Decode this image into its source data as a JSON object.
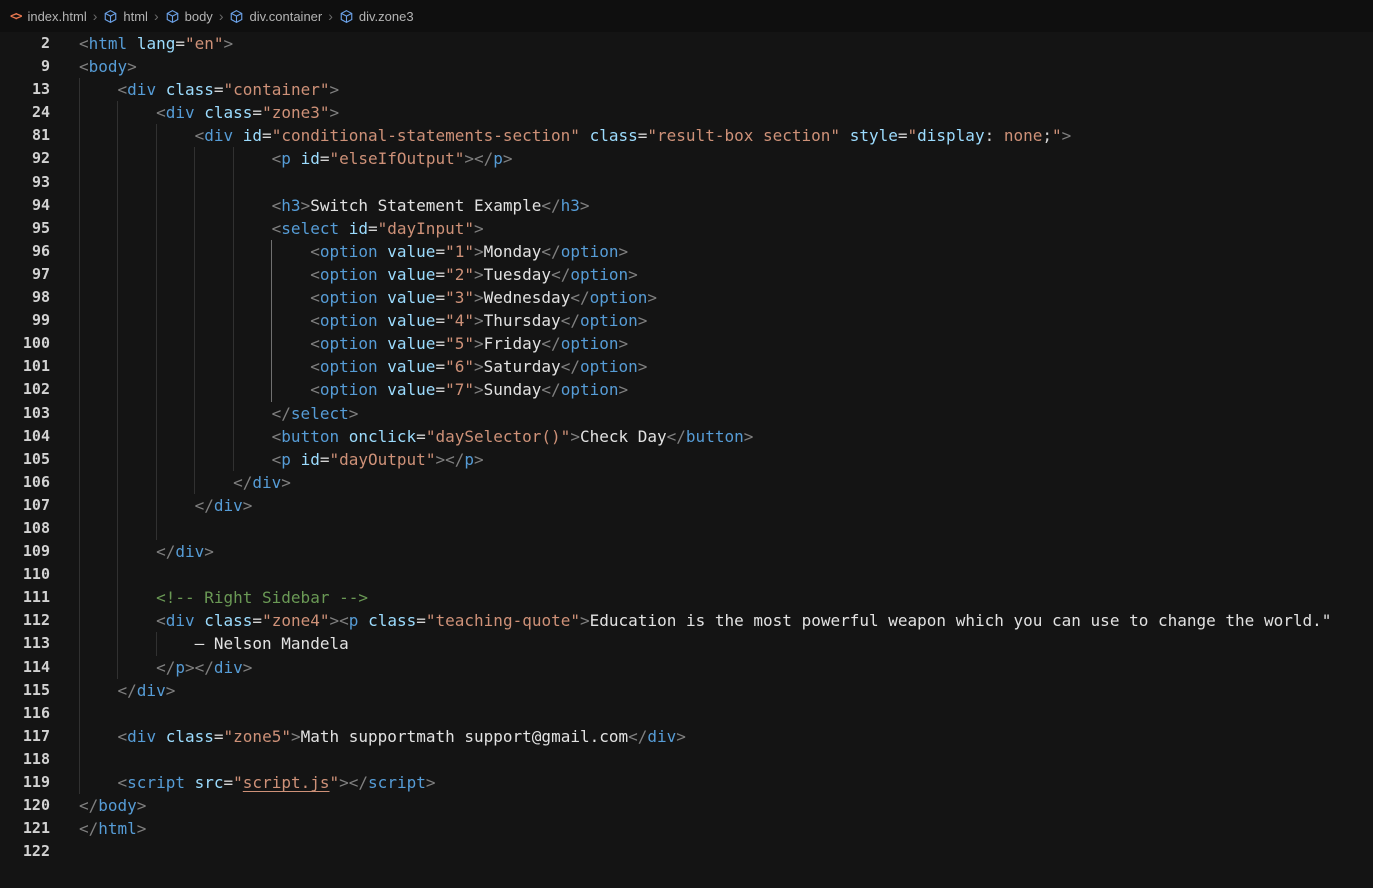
{
  "breadcrumb": {
    "separator": "›",
    "items": [
      {
        "label": "index.html",
        "icon": "html-file-icon"
      },
      {
        "label": "html",
        "icon": "symbol-tag-icon"
      },
      {
        "label": "body",
        "icon": "symbol-tag-icon"
      },
      {
        "label": "div.container",
        "icon": "symbol-tag-icon"
      },
      {
        "label": "div.zone3",
        "icon": "symbol-tag-icon"
      }
    ]
  },
  "colors": {
    "editor_background": "#141414",
    "breadcrumb_background": "#0f0f0f",
    "tag": "#569cd6",
    "attribute": "#9cdcfe",
    "string": "#ce9178",
    "punctuation": "#808080",
    "text": "#e2e2e2",
    "comment": "#6a9955",
    "line_number": "#d2d2d2",
    "indent_guide": "#313131",
    "active_indent_guide": "#707070",
    "html_file_icon": "#e8774f",
    "symbol_icon": "#6ca2e8",
    "link": "#ce9178"
  },
  "editor": {
    "lines": [
      {
        "n": "2",
        "ind": 0,
        "g": 0,
        "tok": [
          [
            "p",
            "<"
          ],
          [
            "tag",
            "html"
          ],
          [
            "t",
            " "
          ],
          [
            "attr",
            "lang"
          ],
          [
            "eq",
            "="
          ],
          [
            "str",
            "\"en\""
          ],
          [
            "p",
            ">"
          ]
        ]
      },
      {
        "n": "9",
        "ind": 0,
        "g": 0,
        "tok": [
          [
            "p",
            "<"
          ],
          [
            "tag",
            "body"
          ],
          [
            "p",
            ">"
          ]
        ]
      },
      {
        "n": "13",
        "ind": 4,
        "g": 1,
        "tok": [
          [
            "p",
            "<"
          ],
          [
            "tag",
            "div"
          ],
          [
            "t",
            " "
          ],
          [
            "attr",
            "class"
          ],
          [
            "eq",
            "="
          ],
          [
            "str",
            "\"container\""
          ],
          [
            "p",
            ">"
          ]
        ]
      },
      {
        "n": "24",
        "ind": 8,
        "g": 2,
        "tok": [
          [
            "p",
            "<"
          ],
          [
            "tag",
            "div"
          ],
          [
            "t",
            " "
          ],
          [
            "attr",
            "class"
          ],
          [
            "eq",
            "="
          ],
          [
            "str",
            "\"zone3\""
          ],
          [
            "p",
            ">"
          ]
        ]
      },
      {
        "n": "81",
        "ind": 12,
        "g": 3,
        "tok": [
          [
            "p",
            "<"
          ],
          [
            "tag",
            "div"
          ],
          [
            "t",
            " "
          ],
          [
            "attr",
            "id"
          ],
          [
            "eq",
            "="
          ],
          [
            "str",
            "\"conditional-statements-section\""
          ],
          [
            "t",
            " "
          ],
          [
            "attr",
            "class"
          ],
          [
            "eq",
            "="
          ],
          [
            "str",
            "\"result-box section\""
          ],
          [
            "t",
            " "
          ],
          [
            "attr",
            "style"
          ],
          [
            "eq",
            "="
          ],
          [
            "str",
            "\""
          ],
          [
            "cprop",
            "display"
          ],
          [
            "eq",
            ": "
          ],
          [
            "str",
            "none"
          ],
          [
            "eq",
            ";"
          ],
          [
            "str",
            "\""
          ],
          [
            "p",
            ">"
          ]
        ]
      },
      {
        "n": "92",
        "ind": 20,
        "g": 5,
        "tok": [
          [
            "p",
            "<"
          ],
          [
            "tag",
            "p"
          ],
          [
            "t",
            " "
          ],
          [
            "attr",
            "id"
          ],
          [
            "eq",
            "="
          ],
          [
            "str",
            "\"elseIfOutput\""
          ],
          [
            "p",
            ">"
          ],
          [
            "p",
            "</"
          ],
          [
            "tag",
            "p"
          ],
          [
            "p",
            ">"
          ]
        ]
      },
      {
        "n": "93",
        "ind": 0,
        "g": 5,
        "tok": []
      },
      {
        "n": "94",
        "ind": 20,
        "g": 5,
        "tok": [
          [
            "p",
            "<"
          ],
          [
            "tag",
            "h3"
          ],
          [
            "p",
            ">"
          ],
          [
            "t",
            "Switch Statement Example"
          ],
          [
            "p",
            "</"
          ],
          [
            "tag",
            "h3"
          ],
          [
            "p",
            ">"
          ]
        ]
      },
      {
        "n": "95",
        "ind": 20,
        "g": 5,
        "tok": [
          [
            "p",
            "<"
          ],
          [
            "tag",
            "select"
          ],
          [
            "t",
            " "
          ],
          [
            "attr",
            "id"
          ],
          [
            "eq",
            "="
          ],
          [
            "str",
            "\"dayInput\""
          ],
          [
            "p",
            ">"
          ]
        ]
      },
      {
        "n": "96",
        "ind": 24,
        "g": 6,
        "a": 5,
        "tok": [
          [
            "p",
            "<"
          ],
          [
            "tag",
            "option"
          ],
          [
            "t",
            " "
          ],
          [
            "attr",
            "value"
          ],
          [
            "eq",
            "="
          ],
          [
            "str",
            "\"1\""
          ],
          [
            "p",
            ">"
          ],
          [
            "t",
            "Monday"
          ],
          [
            "p",
            "</"
          ],
          [
            "tag",
            "option"
          ],
          [
            "p",
            ">"
          ]
        ]
      },
      {
        "n": "97",
        "ind": 24,
        "g": 6,
        "a": 5,
        "tok": [
          [
            "p",
            "<"
          ],
          [
            "tag",
            "option"
          ],
          [
            "t",
            " "
          ],
          [
            "attr",
            "value"
          ],
          [
            "eq",
            "="
          ],
          [
            "str",
            "\"2\""
          ],
          [
            "p",
            ">"
          ],
          [
            "t",
            "Tuesday"
          ],
          [
            "p",
            "</"
          ],
          [
            "tag",
            "option"
          ],
          [
            "p",
            ">"
          ]
        ]
      },
      {
        "n": "98",
        "ind": 24,
        "g": 6,
        "a": 5,
        "tok": [
          [
            "p",
            "<"
          ],
          [
            "tag",
            "option"
          ],
          [
            "t",
            " "
          ],
          [
            "attr",
            "value"
          ],
          [
            "eq",
            "="
          ],
          [
            "str",
            "\"3\""
          ],
          [
            "p",
            ">"
          ],
          [
            "t",
            "Wednesday"
          ],
          [
            "p",
            "</"
          ],
          [
            "tag",
            "option"
          ],
          [
            "p",
            ">"
          ]
        ]
      },
      {
        "n": "99",
        "ind": 24,
        "g": 6,
        "a": 5,
        "tok": [
          [
            "p",
            "<"
          ],
          [
            "tag",
            "option"
          ],
          [
            "t",
            " "
          ],
          [
            "attr",
            "value"
          ],
          [
            "eq",
            "="
          ],
          [
            "str",
            "\"4\""
          ],
          [
            "p",
            ">"
          ],
          [
            "t",
            "Thursday"
          ],
          [
            "p",
            "</"
          ],
          [
            "tag",
            "option"
          ],
          [
            "p",
            ">"
          ]
        ]
      },
      {
        "n": "100",
        "ind": 24,
        "g": 6,
        "a": 5,
        "tok": [
          [
            "p",
            "<"
          ],
          [
            "tag",
            "option"
          ],
          [
            "t",
            " "
          ],
          [
            "attr",
            "value"
          ],
          [
            "eq",
            "="
          ],
          [
            "str",
            "\"5\""
          ],
          [
            "p",
            ">"
          ],
          [
            "t",
            "Friday"
          ],
          [
            "p",
            "</"
          ],
          [
            "tag",
            "option"
          ],
          [
            "p",
            ">"
          ]
        ]
      },
      {
        "n": "101",
        "ind": 24,
        "g": 6,
        "a": 5,
        "tok": [
          [
            "p",
            "<"
          ],
          [
            "tag",
            "option"
          ],
          [
            "t",
            " "
          ],
          [
            "attr",
            "value"
          ],
          [
            "eq",
            "="
          ],
          [
            "str",
            "\"6\""
          ],
          [
            "p",
            ">"
          ],
          [
            "t",
            "Saturday"
          ],
          [
            "p",
            "</"
          ],
          [
            "tag",
            "option"
          ],
          [
            "p",
            ">"
          ]
        ]
      },
      {
        "n": "102",
        "ind": 24,
        "g": 6,
        "a": 5,
        "tok": [
          [
            "p",
            "<"
          ],
          [
            "tag",
            "option"
          ],
          [
            "t",
            " "
          ],
          [
            "attr",
            "value"
          ],
          [
            "eq",
            "="
          ],
          [
            "str",
            "\"7\""
          ],
          [
            "p",
            ">"
          ],
          [
            "t",
            "Sunday"
          ],
          [
            "p",
            "</"
          ],
          [
            "tag",
            "option"
          ],
          [
            "p",
            ">"
          ]
        ]
      },
      {
        "n": "103",
        "ind": 20,
        "g": 5,
        "tok": [
          [
            "p",
            "</"
          ],
          [
            "tag",
            "select"
          ],
          [
            "p",
            ">"
          ]
        ]
      },
      {
        "n": "104",
        "ind": 20,
        "g": 5,
        "tok": [
          [
            "p",
            "<"
          ],
          [
            "tag",
            "button"
          ],
          [
            "t",
            " "
          ],
          [
            "attr",
            "onclick"
          ],
          [
            "eq",
            "="
          ],
          [
            "str",
            "\"daySelector()\""
          ],
          [
            "p",
            ">"
          ],
          [
            "t",
            "Check Day"
          ],
          [
            "p",
            "</"
          ],
          [
            "tag",
            "button"
          ],
          [
            "p",
            ">"
          ]
        ]
      },
      {
        "n": "105",
        "ind": 20,
        "g": 5,
        "tok": [
          [
            "p",
            "<"
          ],
          [
            "tag",
            "p"
          ],
          [
            "t",
            " "
          ],
          [
            "attr",
            "id"
          ],
          [
            "eq",
            "="
          ],
          [
            "str",
            "\"dayOutput\""
          ],
          [
            "p",
            ">"
          ],
          [
            "p",
            "</"
          ],
          [
            "tag",
            "p"
          ],
          [
            "p",
            ">"
          ]
        ]
      },
      {
        "n": "106",
        "ind": 16,
        "g": 4,
        "tok": [
          [
            "p",
            "</"
          ],
          [
            "tag",
            "div"
          ],
          [
            "p",
            ">"
          ]
        ]
      },
      {
        "n": "107",
        "ind": 12,
        "g": 3,
        "tok": [
          [
            "p",
            "</"
          ],
          [
            "tag",
            "div"
          ],
          [
            "p",
            ">"
          ]
        ]
      },
      {
        "n": "108",
        "ind": 0,
        "g": 3,
        "tok": []
      },
      {
        "n": "109",
        "ind": 8,
        "g": 2,
        "tok": [
          [
            "p",
            "</"
          ],
          [
            "tag",
            "div"
          ],
          [
            "p",
            ">"
          ]
        ]
      },
      {
        "n": "110",
        "ind": 0,
        "g": 2,
        "tok": []
      },
      {
        "n": "111",
        "ind": 8,
        "g": 2,
        "tok": [
          [
            "c",
            "<!-- Right Sidebar -->"
          ]
        ]
      },
      {
        "n": "112",
        "ind": 8,
        "g": 2,
        "tok": [
          [
            "p",
            "<"
          ],
          [
            "tag",
            "div"
          ],
          [
            "t",
            " "
          ],
          [
            "attr",
            "class"
          ],
          [
            "eq",
            "="
          ],
          [
            "str",
            "\"zone4\""
          ],
          [
            "p",
            ">"
          ],
          [
            "p",
            "<"
          ],
          [
            "tag",
            "p"
          ],
          [
            "t",
            " "
          ],
          [
            "attr",
            "class"
          ],
          [
            "eq",
            "="
          ],
          [
            "str",
            "\"teaching-quote\""
          ],
          [
            "p",
            ">"
          ],
          [
            "t",
            "Education is the most powerful weapon which you can use to change the world.\""
          ]
        ]
      },
      {
        "n": "113",
        "ind": 12,
        "g": 3,
        "tok": [
          [
            "t",
            "— Nelson Mandela"
          ]
        ]
      },
      {
        "n": "114",
        "ind": 8,
        "g": 2,
        "tok": [
          [
            "p",
            "</"
          ],
          [
            "tag",
            "p"
          ],
          [
            "p",
            ">"
          ],
          [
            "p",
            "</"
          ],
          [
            "tag",
            "div"
          ],
          [
            "p",
            ">"
          ]
        ]
      },
      {
        "n": "115",
        "ind": 4,
        "g": 1,
        "tok": [
          [
            "p",
            "</"
          ],
          [
            "tag",
            "div"
          ],
          [
            "p",
            ">"
          ]
        ]
      },
      {
        "n": "116",
        "ind": 0,
        "g": 1,
        "tok": []
      },
      {
        "n": "117",
        "ind": 4,
        "g": 1,
        "tok": [
          [
            "p",
            "<"
          ],
          [
            "tag",
            "div"
          ],
          [
            "t",
            " "
          ],
          [
            "attr",
            "class"
          ],
          [
            "eq",
            "="
          ],
          [
            "str",
            "\"zone5\""
          ],
          [
            "p",
            ">"
          ],
          [
            "t",
            "Math supportmath support@gmail.com"
          ],
          [
            "p",
            "</"
          ],
          [
            "tag",
            "div"
          ],
          [
            "p",
            ">"
          ]
        ]
      },
      {
        "n": "118",
        "ind": 0,
        "g": 1,
        "tok": []
      },
      {
        "n": "119",
        "ind": 4,
        "g": 1,
        "tok": [
          [
            "p",
            "<"
          ],
          [
            "tag",
            "script"
          ],
          [
            "t",
            " "
          ],
          [
            "attr",
            "src"
          ],
          [
            "eq",
            "="
          ],
          [
            "str",
            "\""
          ],
          [
            "link",
            "script.js"
          ],
          [
            "str",
            "\""
          ],
          [
            "p",
            ">"
          ],
          [
            "p",
            "</"
          ],
          [
            "tag",
            "script"
          ],
          [
            "p",
            ">"
          ]
        ]
      },
      {
        "n": "120",
        "ind": 0,
        "g": 0,
        "tok": [
          [
            "p",
            "</"
          ],
          [
            "tag",
            "body"
          ],
          [
            "p",
            ">"
          ]
        ]
      },
      {
        "n": "121",
        "ind": 0,
        "g": 0,
        "tok": [
          [
            "p",
            "</"
          ],
          [
            "tag",
            "html"
          ],
          [
            "p",
            ">"
          ]
        ]
      },
      {
        "n": "122",
        "ind": 0,
        "g": 0,
        "tok": []
      }
    ]
  }
}
